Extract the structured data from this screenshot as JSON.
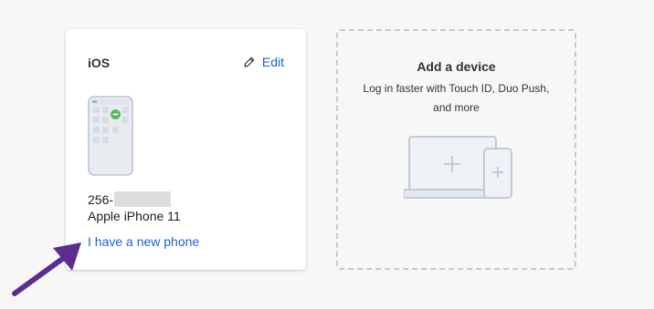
{
  "device_card": {
    "platform": "iOS",
    "edit_label": "Edit",
    "phone_number_prefix": "256-",
    "device_model": "Apple iPhone 11",
    "new_phone_link": "I have a new phone"
  },
  "add_device_card": {
    "title": "Add a device",
    "description": "Log in faster with Touch ID, Duo Push, and more"
  },
  "icons": {
    "edit": "pencil-icon",
    "phone": "phone-illustration-icon",
    "add_device": "laptop-phone-plus-icon",
    "annotation": "arrow-annotation-icon"
  },
  "colors": {
    "link": "#1f63c6",
    "annotation_arrow": "#5b2d8e",
    "badge_green": "#5cb85c"
  }
}
